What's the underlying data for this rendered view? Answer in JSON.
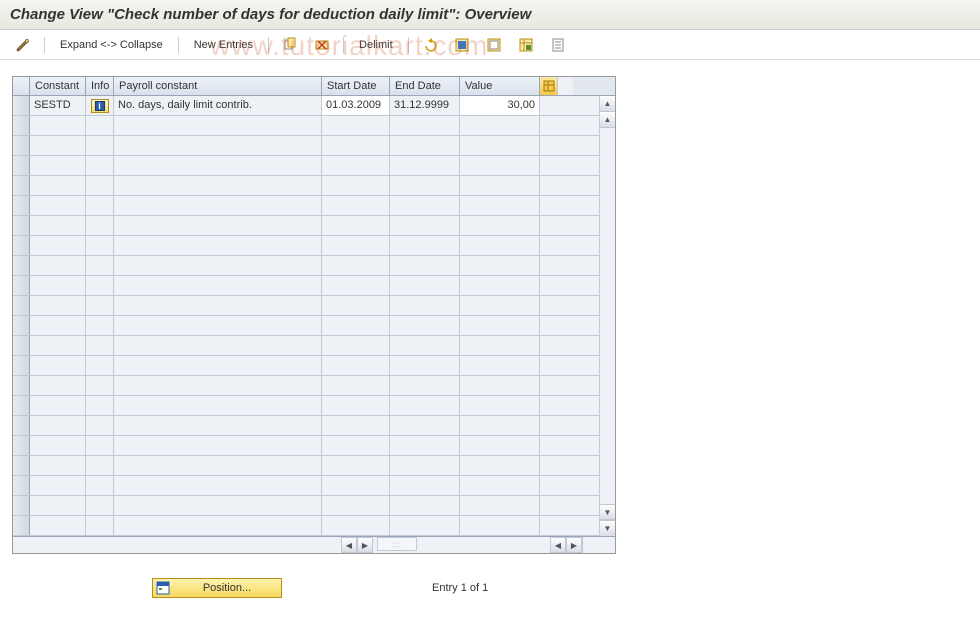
{
  "title": "Change View \"Check number of days for deduction daily limit\": Overview",
  "toolbar": {
    "expand_collapse": "Expand <-> Collapse",
    "new_entries": "New Entries",
    "delimit": "Delimit"
  },
  "columns": {
    "constant": "Constant",
    "info": "Info",
    "payroll": "Payroll constant",
    "start": "Start Date",
    "end": "End Date",
    "value": "Value"
  },
  "rows": [
    {
      "constant": "SESTD",
      "payroll": "No. days, daily limit contrib.",
      "start": "01.03.2009",
      "end": "31.12.9999",
      "value": "30,00"
    }
  ],
  "footer": {
    "position": "Position...",
    "entry": "Entry 1 of 1"
  },
  "watermark": "www.tutorialkart.com",
  "info_glyph": "i"
}
